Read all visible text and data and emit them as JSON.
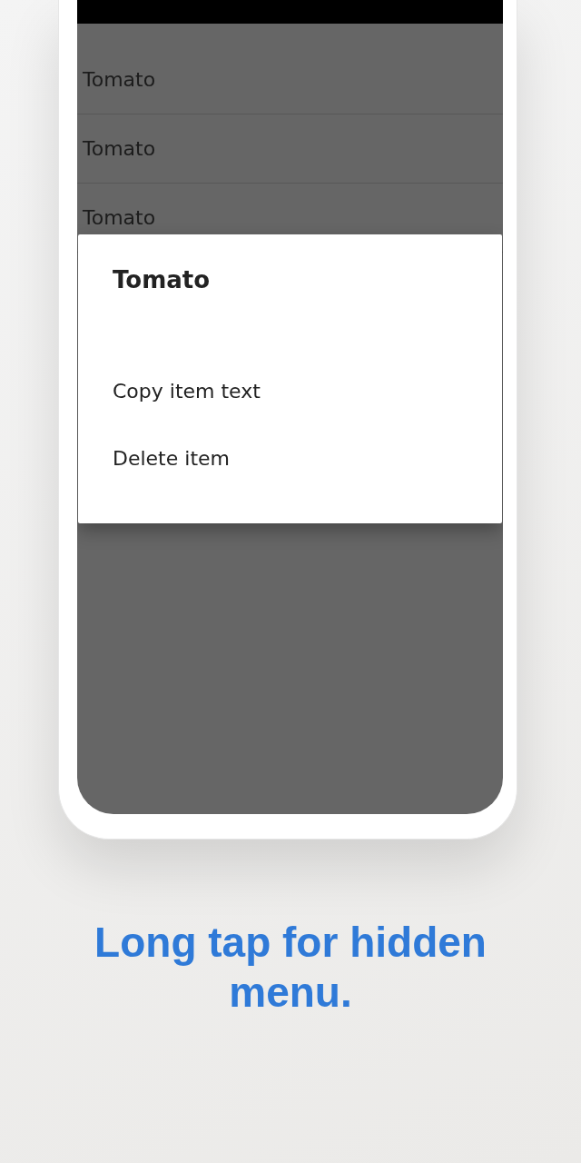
{
  "list": {
    "items": [
      "Tomato",
      "Tomato",
      "Tomato"
    ]
  },
  "dialog": {
    "title": "Tomato",
    "menu_items": [
      "Copy item text",
      "Delete item"
    ]
  },
  "caption": "Long tap for hidden menu."
}
